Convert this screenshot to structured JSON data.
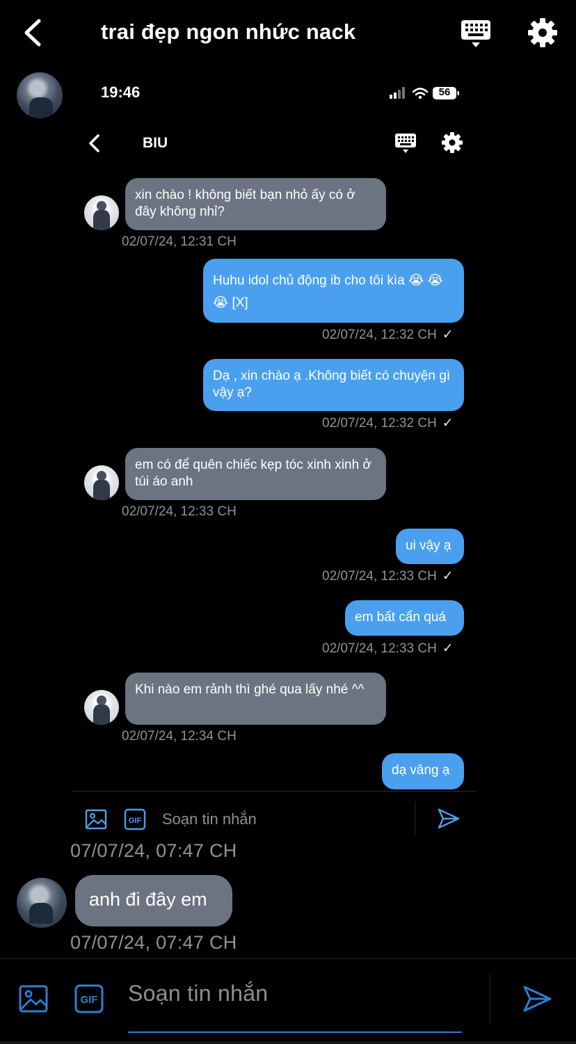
{
  "header": {
    "title": "trai đẹp ngon nhức nack"
  },
  "screenshot": {
    "status_time": "19:46",
    "battery": "56",
    "chat_title": "BIU",
    "messages": [
      {
        "dir": "in",
        "text": "xin chào ! không biết bạn nhỏ ấy có ở đây không nhỉ?",
        "ts": "02/07/24, 12:31 CH"
      },
      {
        "dir": "out",
        "text": "Huhu idol chủ động ib cho tôi kìa 😭 😭 😭 [X]",
        "ts": "02/07/24, 12:32 CH"
      },
      {
        "dir": "out",
        "text": "Dạ , xin chào ạ .Không biết có chuyện gì vậy ạ?",
        "ts": "02/07/24, 12:32 CH"
      },
      {
        "dir": "in",
        "text": "em có để quên chiếc kẹp tóc xinh xinh ở túi áo anh",
        "ts": "02/07/24, 12:33 CH"
      },
      {
        "dir": "out",
        "text": "ui vậy ạ",
        "ts": "02/07/24, 12:33 CH"
      },
      {
        "dir": "out",
        "text": "em bất cẩn quá",
        "ts": "02/07/24, 12:33 CH"
      },
      {
        "dir": "in",
        "text": "Khi nào em rảnh thì ghé qua lấy nhé ^^",
        "ts": "02/07/24, 12:34 CH"
      },
      {
        "dir": "out",
        "text": "dạ vâng ạ",
        "ts": ""
      }
    ],
    "composer_placeholder": "Soạn tin nhắn",
    "check_mark": "✓"
  },
  "chat": {
    "screenshot_ts": "07/07/24, 07:47 CH",
    "message_text": "anh đi đây em",
    "message_ts": "07/07/24, 07:47 CH"
  },
  "composer": {
    "placeholder": "Soạn tin nhắn",
    "gif_label": "GIF"
  },
  "colors": {
    "background": "#000000",
    "incoming_bubble": "#6b7480",
    "outgoing_bubble": "#4aa0ee",
    "accent": "#2b7fd6",
    "timestamp": "#8e949b"
  },
  "icons": [
    "back-arrow-icon",
    "keyboard-icon",
    "gear-icon",
    "image-icon",
    "gif-icon",
    "send-icon",
    "signal-icon",
    "wifi-icon",
    "battery-icon"
  ]
}
